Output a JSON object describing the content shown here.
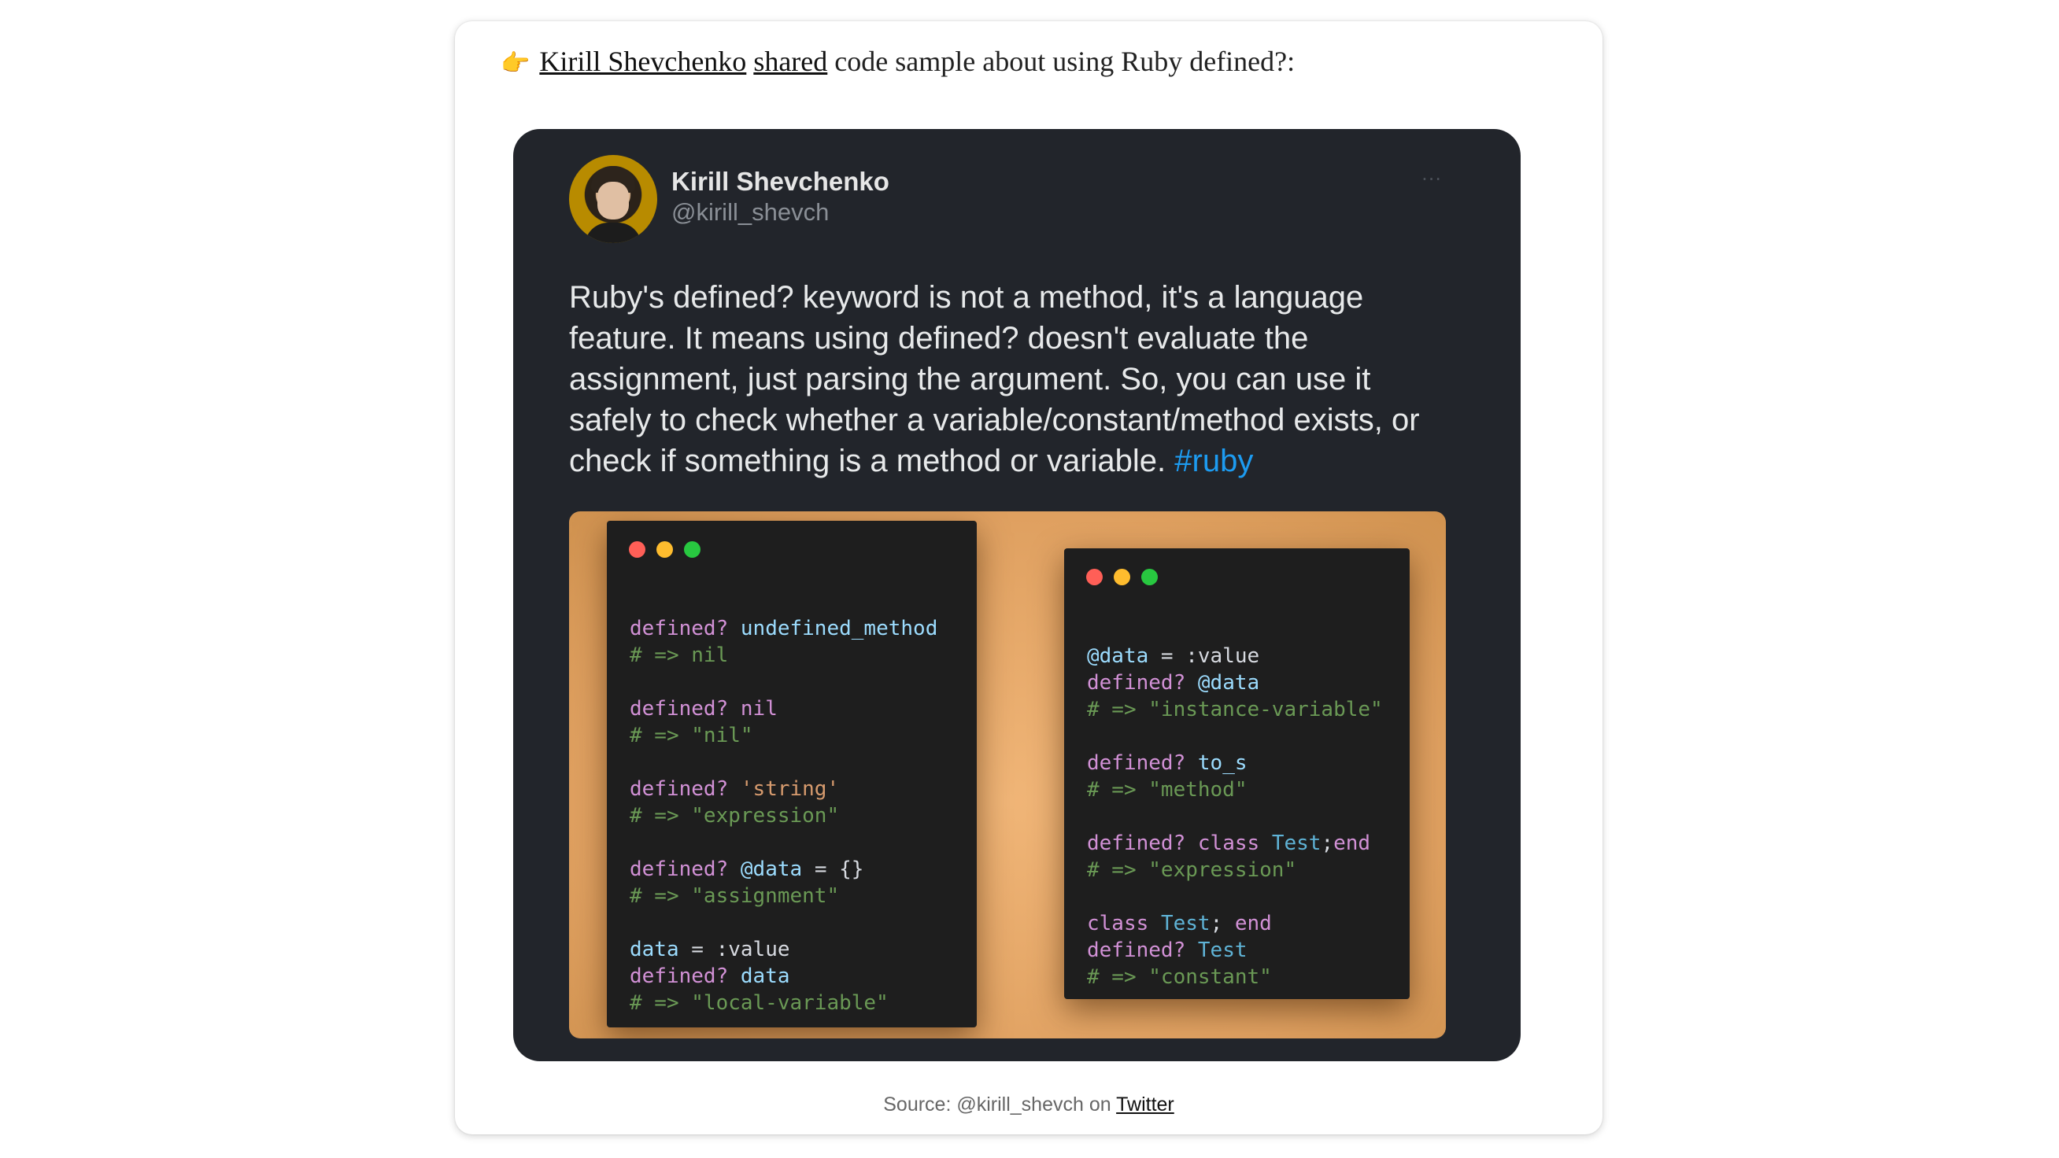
{
  "intro": {
    "emoji": "👉",
    "author": "Kirill Shevchenko",
    "shared": "shared",
    "text": " code sample about using Ruby defined?:"
  },
  "tweet": {
    "name": "Kirill Shevchenko",
    "handle": "@kirill_shevch",
    "more": "···",
    "body": "Ruby's defined? keyword is not a method, it's a language feature. It means using defined? doesn't evaluate the assignment, just parsing the argument. So, you can use it safely to check whether a variable/constant/method exists, or check if something is a method or variable.",
    "hashtag": "#ruby"
  },
  "code_left": {
    "b1": {
      "kw": "defined?",
      "arg": "undefined_method",
      "cm": "# => nil"
    },
    "b2": {
      "kw": "defined?",
      "arg": "nil",
      "cm": "# => \"nil\""
    },
    "b3": {
      "kw": "defined?",
      "arg": "'string'",
      "cm": "# => \"expression\""
    },
    "b4": {
      "kw": "defined?",
      "arg": "@data",
      "rest": " = {}",
      "cm": "# => \"assignment\""
    },
    "b5": {
      "var": "data",
      "rest": " = :value",
      "kw": "defined?",
      "arg": "data",
      "cm": "# => \"local-variable\""
    }
  },
  "code_right": {
    "b1": {
      "var": "@data",
      "rest": " = :value",
      "kw": "defined?",
      "arg": "@data",
      "cm": "# => \"instance-variable\""
    },
    "b2": {
      "kw": "defined?",
      "arg": "to_s",
      "cm": "# => \"method\""
    },
    "b3": {
      "kw": "defined?",
      "kw2": "class",
      "cls": "Test",
      "semi": ";",
      "end": "end",
      "cm": "# => \"expression\""
    },
    "b4": {
      "kw": "class",
      "cls": "Test",
      "semi": "; ",
      "end": "end",
      "kw2": "defined?",
      "cls2": "Test",
      "cm": "# => \"constant\""
    }
  },
  "source": {
    "prefix": "Source: @kirill_shevch on ",
    "link": "Twitter"
  }
}
